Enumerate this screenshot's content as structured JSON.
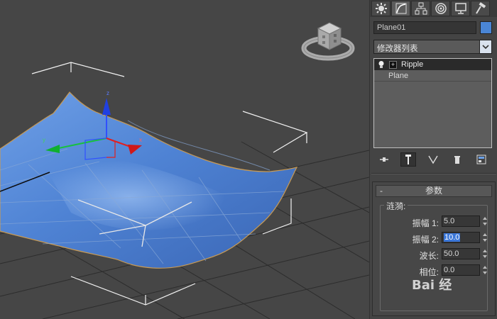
{
  "command_panel": {
    "tabs": [
      {
        "name": "create-tab",
        "icon": "sun-gear-icon"
      },
      {
        "name": "modify-tab",
        "icon": "curve-modify-icon"
      },
      {
        "name": "hierarchy-tab",
        "icon": "hierarchy-icon"
      },
      {
        "name": "motion-tab",
        "icon": "motion-circle-icon"
      },
      {
        "name": "display-tab",
        "icon": "monitor-icon"
      },
      {
        "name": "utilities-tab",
        "icon": "hammer-icon"
      }
    ],
    "object_name": "Plane01",
    "object_color": "#4a86d6",
    "modifier_list_label": "修改器列表",
    "stack": [
      {
        "label": "Ripple",
        "selected": true
      },
      {
        "label": "Plane",
        "selected": false
      }
    ]
  },
  "parameters": {
    "rollout_title": "参数",
    "rollout_toggle": "-",
    "group_label": "涟漪:",
    "fields": [
      {
        "label": "振幅 1:",
        "value": "5.0"
      },
      {
        "label": "振幅 2:",
        "value": "10.0"
      },
      {
        "label": "波长:",
        "value": "50.0"
      },
      {
        "label": "相位:",
        "value": "0.0"
      }
    ]
  },
  "watermark": "Bai 经"
}
